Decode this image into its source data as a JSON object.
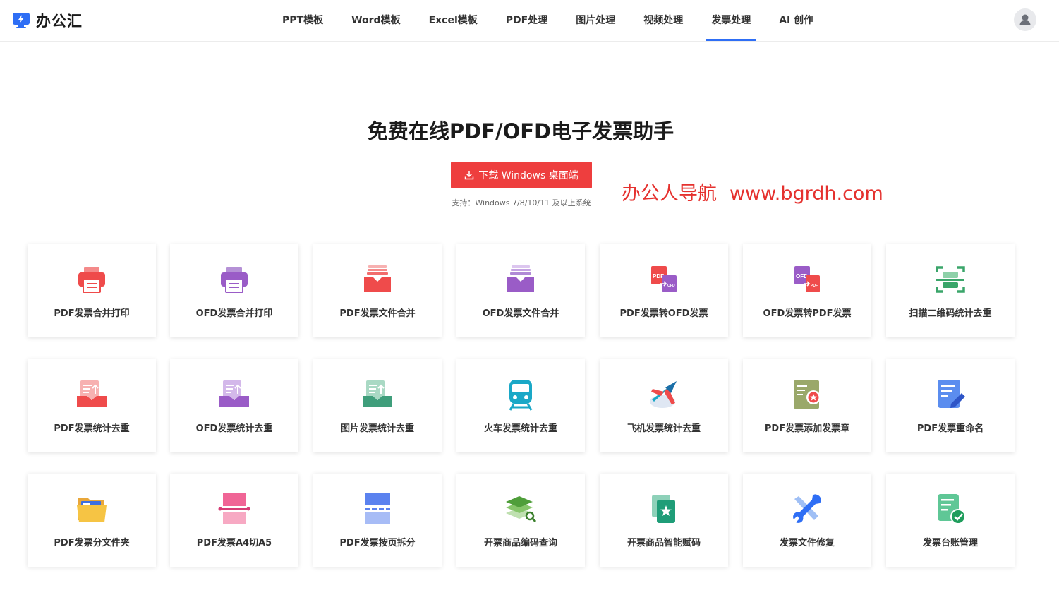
{
  "brand": {
    "name": "办公汇",
    "color": "#2e6ef5"
  },
  "nav": {
    "items": [
      {
        "label": "PPT模板"
      },
      {
        "label": "Word模板"
      },
      {
        "label": "Excel模板"
      },
      {
        "label": "PDF处理"
      },
      {
        "label": "图片处理"
      },
      {
        "label": "视频处理"
      },
      {
        "label": "发票处理",
        "active": true
      },
      {
        "label": "AI 创作"
      }
    ]
  },
  "hero": {
    "title": "免费在线PDF/OFD电子发票助手",
    "download_label": "下载 Windows 桌面端",
    "support_text": "支持：Windows 7/8/10/11 及以上系统",
    "button_color": "#ee3e3e"
  },
  "watermark": {
    "name": "办公人导航",
    "url": "www.bgrdh.com",
    "color": "#e5312e"
  },
  "tools": [
    {
      "label": "PDF发票合并打印",
      "icon": "printer-red-icon"
    },
    {
      "label": "OFD发票合并打印",
      "icon": "printer-purple-icon"
    },
    {
      "label": "PDF发票文件合并",
      "icon": "file-merge-red-icon"
    },
    {
      "label": "OFD发票文件合并",
      "icon": "file-merge-purple-icon"
    },
    {
      "label": "PDF发票转OFD发票",
      "icon": "pdf-to-ofd-icon"
    },
    {
      "label": "OFD发票转PDF发票",
      "icon": "ofd-to-pdf-icon"
    },
    {
      "label": "扫描二维码统计去重",
      "icon": "qr-scan-icon"
    },
    {
      "label": "PDF发票统计去重",
      "icon": "stats-red-icon"
    },
    {
      "label": "OFD发票统计去重",
      "icon": "stats-purple-icon"
    },
    {
      "label": "图片发票统计去重",
      "icon": "stats-green-icon"
    },
    {
      "label": "火车发票统计去重",
      "icon": "train-icon"
    },
    {
      "label": "飞机发票统计去重",
      "icon": "airplane-icon"
    },
    {
      "label": "PDF发票添加发票章",
      "icon": "stamp-icon"
    },
    {
      "label": "PDF发票重命名",
      "icon": "rename-icon"
    },
    {
      "label": "PDF发票分文件夹",
      "icon": "folder-icon"
    },
    {
      "label": "PDF发票A4切A5",
      "icon": "cut-icon"
    },
    {
      "label": "PDF发票按页拆分",
      "icon": "split-icon"
    },
    {
      "label": "开票商品编码查询",
      "icon": "code-search-icon"
    },
    {
      "label": "开票商品智能赋码",
      "icon": "smart-code-icon"
    },
    {
      "label": "发票文件修复",
      "icon": "repair-icon"
    },
    {
      "label": "发票台账管理",
      "icon": "ledger-icon"
    }
  ]
}
